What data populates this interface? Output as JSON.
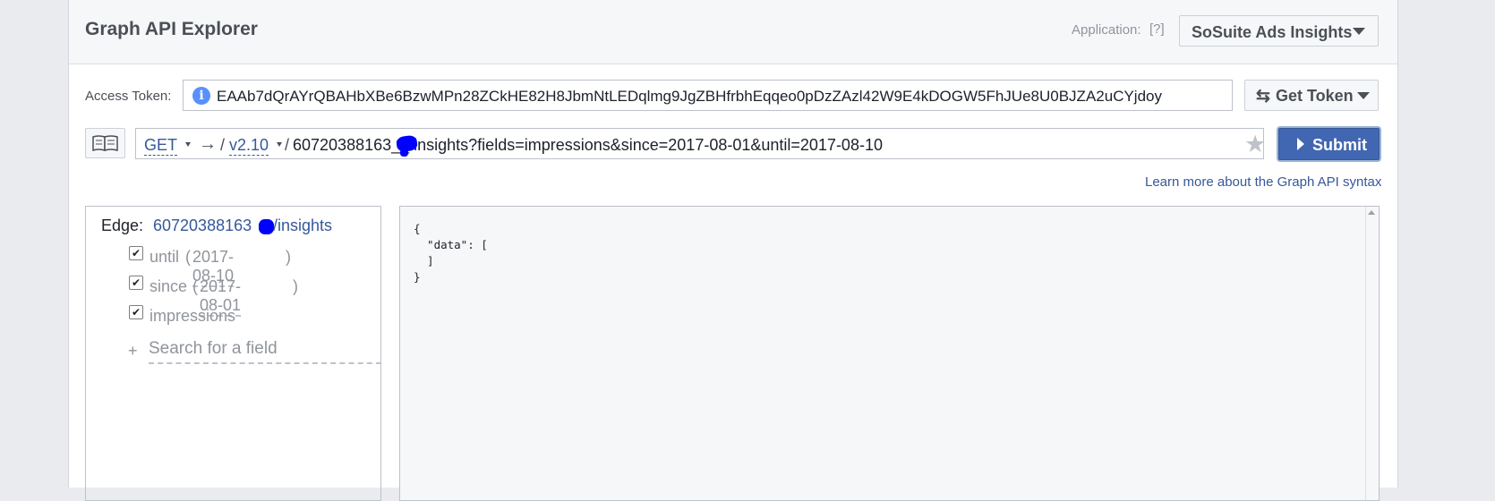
{
  "header": {
    "title": "Graph API Explorer",
    "application_label": "Application:",
    "help_label": "[?]",
    "application_name": "SoSuite Ads Insights"
  },
  "token": {
    "label": "Access Token:",
    "value": "EAAb7dQrAYrQBAHbXBe6BzwMPn28ZCkHE82H8JbmNtLEDqlmg9JgZBHfrbhEqqeo0pDzZAzl42W9E4kDOGW5FhJUe8U0BJZA2uCYjdoy",
    "get_token_label": "Get Token"
  },
  "request": {
    "method": "GET",
    "arrow": "→",
    "slash": "/",
    "version": "v2.10",
    "path": "60720388163__/insights?fields=impressions&since=2017-08-01&until=2017-08-10",
    "submit_label": "Submit",
    "learn_more": "Learn more about the Graph API syntax"
  },
  "explorer": {
    "edge_label": "Edge:",
    "edge_id": "60720388163",
    "edge_path": "/insights",
    "fields": [
      {
        "name": "until",
        "checked": true,
        "value": "2017-08-10"
      },
      {
        "name": "since",
        "checked": true,
        "value": "2017-08-01"
      },
      {
        "name": "impressions",
        "checked": true
      }
    ],
    "add_symbol": "+",
    "search_placeholder": "Search for a field"
  },
  "response": {
    "body": "{\n  \"data\": [\n  ]\n}"
  },
  "colors": {
    "brand": "#4267b2",
    "link": "#365899",
    "redaction": "#0000ff"
  },
  "icons": {
    "info": "info-icon",
    "swap": "swap-icon",
    "book": "book-icon",
    "star": "star-icon",
    "checkmark": "checkmark-icon",
    "play": "play-icon"
  }
}
